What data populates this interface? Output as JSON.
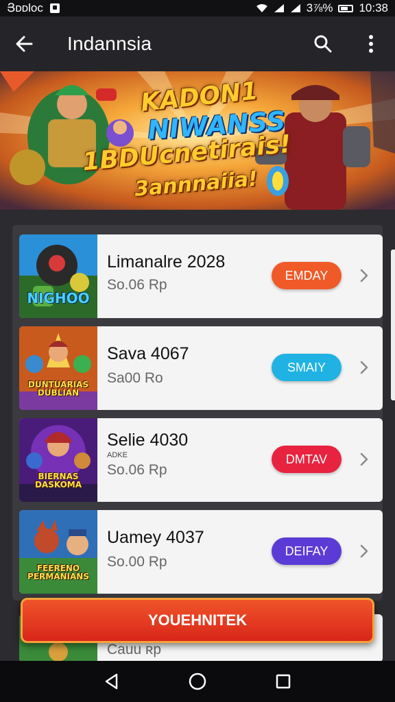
{
  "status_bar": {
    "carrier": "Յᴅᴅlᴏᴄ",
    "battery": "3⅞%",
    "time": "10:38"
  },
  "app_bar": {
    "title": "Indannsia"
  },
  "banner": {
    "lines": [
      "KADON1",
      "NIWANSS",
      "1BDUcnetirais!",
      "3annnaiia!"
    ]
  },
  "list": {
    "items": [
      {
        "title": "Limanalre 2028",
        "subtitle": "",
        "price": "So.06 Rp",
        "button": "EMDAY",
        "button_color": "#f05a28",
        "thumb_caption": "NIGHOO",
        "thumb_bg": "#3a8c2e"
      },
      {
        "title": "Sava 4067",
        "subtitle": "",
        "price": "Sa00 Ro",
        "button": "SMAIY",
        "button_color": "#1fb2e3",
        "thumb_caption": "DUNTUARIAS DUBLIAN",
        "thumb_bg": "#8b3d1f"
      },
      {
        "title": "Selie 4030",
        "subtitle": "ADKE",
        "price": "So.06 Rp",
        "button": "DMTAV",
        "button_color": "#e8233f",
        "thumb_caption": "BIERNAS DASKOMA",
        "thumb_bg": "#5a1f8c"
      },
      {
        "title": "Uamey 4037",
        "subtitle": "",
        "price": "So.00 Rp",
        "button": "DEIFAY",
        "button_color": "#5b3bd6",
        "thumb_caption": "FEERENO PERMANIANS",
        "thumb_bg": "#2f6fb8"
      }
    ],
    "partial_item_text": "Cauu ʀp"
  },
  "cta": {
    "label": "YOUEHNITEK"
  }
}
